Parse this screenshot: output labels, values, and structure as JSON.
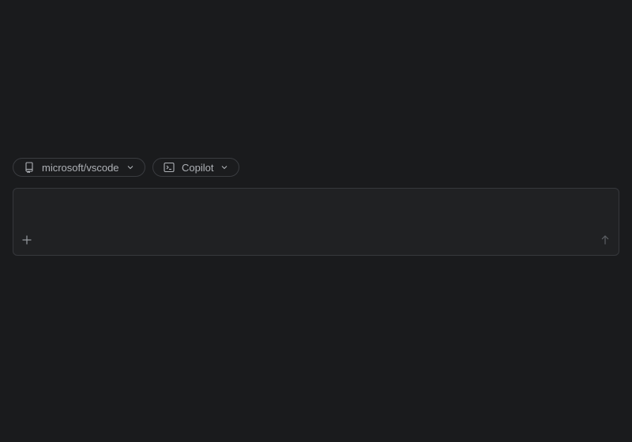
{
  "toolbar": {
    "repo_selector": {
      "label": "microsoft/vscode",
      "icon": "repo-icon"
    },
    "agent_selector": {
      "label": "Copilot",
      "icon": "terminal-icon"
    }
  },
  "composer": {
    "value": "",
    "placeholder": "",
    "add_icon": "plus-icon",
    "send_icon": "arrow-up-icon"
  },
  "colors": {
    "background": "#1a1b1d",
    "composer_bg": "#202123",
    "border": "#3a3c40",
    "text": "#aeb1b6"
  }
}
